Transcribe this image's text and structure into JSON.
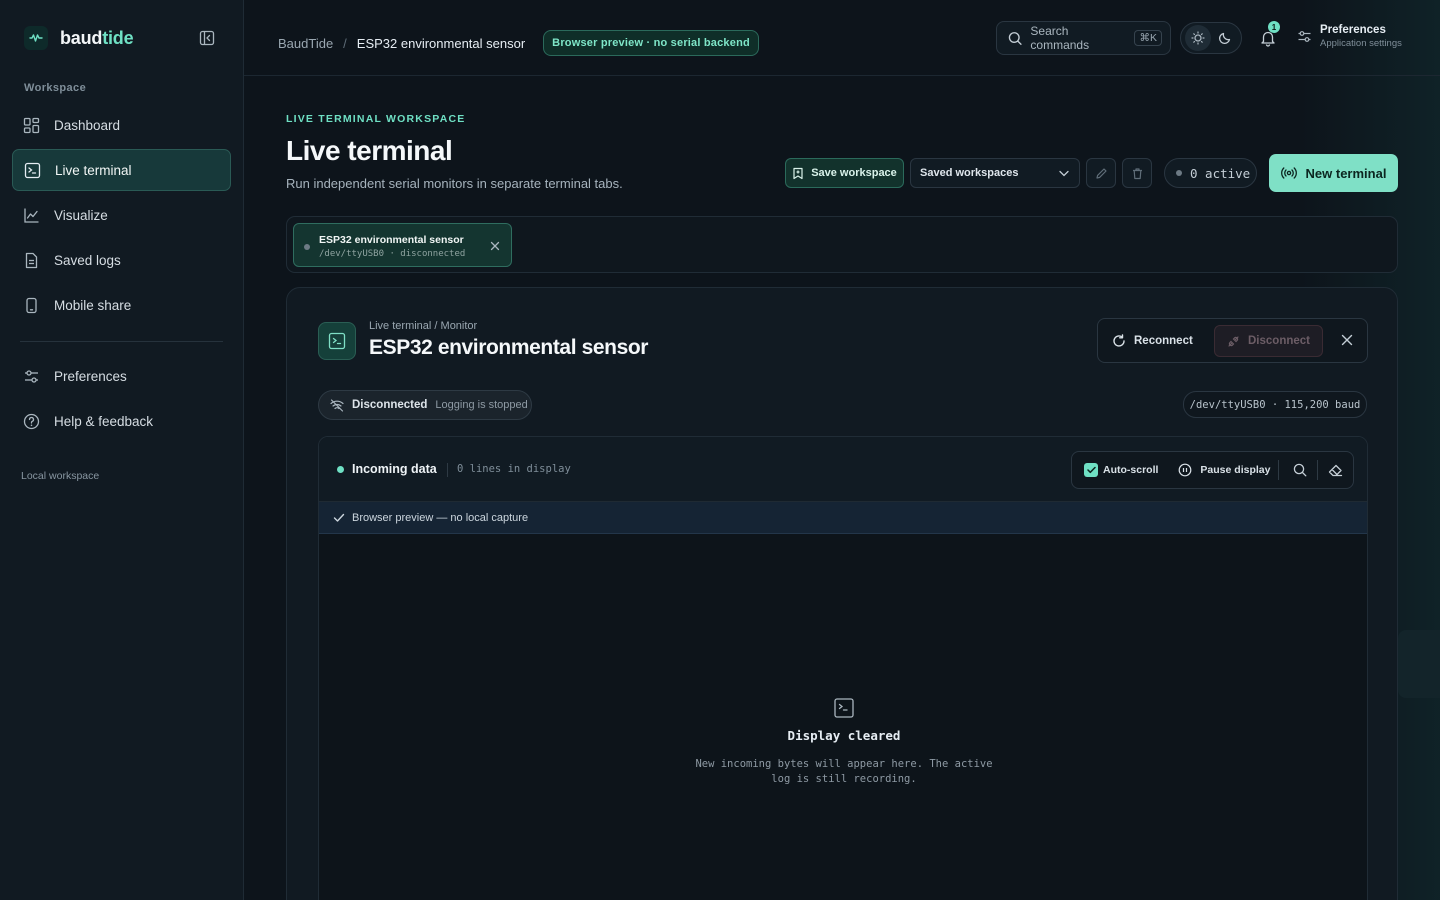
{
  "brand": {
    "name_part1": "baud",
    "name_part2": "tide"
  },
  "sidebar": {
    "section_label": "Workspace",
    "items": [
      {
        "label": "Dashboard",
        "icon": "dashboard-icon",
        "active": false
      },
      {
        "label": "Live terminal",
        "icon": "terminal-icon",
        "active": true
      },
      {
        "label": "Visualize",
        "icon": "chart-icon",
        "active": false
      },
      {
        "label": "Saved logs",
        "icon": "document-icon",
        "active": false
      },
      {
        "label": "Mobile share",
        "icon": "phone-icon",
        "active": false
      }
    ],
    "secondary_items": [
      {
        "label": "Preferences",
        "icon": "sliders-icon"
      },
      {
        "label": "Help & feedback",
        "icon": "help-icon"
      }
    ],
    "footer": "Local workspace"
  },
  "topbar": {
    "breadcrumb_root": "BaudTide",
    "breadcrumb_sep": "/",
    "breadcrumb_current": "ESP32 environmental sensor",
    "preview_badge": "Browser preview · no serial backend",
    "search_placeholder": "Search commands",
    "search_shortcut": "⌘K",
    "notification_count": "1",
    "preferences_title": "Preferences",
    "preferences_subtitle": "Application settings"
  },
  "header": {
    "eyebrow": "LIVE TERMINAL WORKSPACE",
    "title": "Live terminal",
    "subtitle": "Run independent serial monitors in separate terminal tabs.",
    "save_label": "Save workspace",
    "saved_select": "Saved workspaces",
    "active_count": "0 active",
    "new_terminal": "New terminal"
  },
  "tabs": [
    {
      "title": "ESP32 environmental sensor",
      "subtitle": "/dev/ttyUSB0 · disconnected"
    }
  ],
  "panel": {
    "crumb": "Live terminal / Monitor",
    "title": "ESP32 environmental sensor",
    "reconnect": "Reconnect",
    "disconnect": "Disconnect",
    "status_strong": "Disconnected",
    "status_muted": "Logging is stopped",
    "port_info": "/dev/ttyUSB0 · 115,200 baud",
    "data_title": "Incoming data",
    "line_count": "0 lines in display",
    "autoscroll": "Auto-scroll",
    "pause": "Pause display",
    "notice": "Browser preview — no local capture",
    "empty_title": "Display cleared",
    "empty_text": "New incoming bytes will appear here. The active log is still recording."
  },
  "colors": {
    "accent": "#6fe0c4",
    "background": "#0d141b",
    "sidebar": "#111a22",
    "active_nav": "#17393a"
  }
}
